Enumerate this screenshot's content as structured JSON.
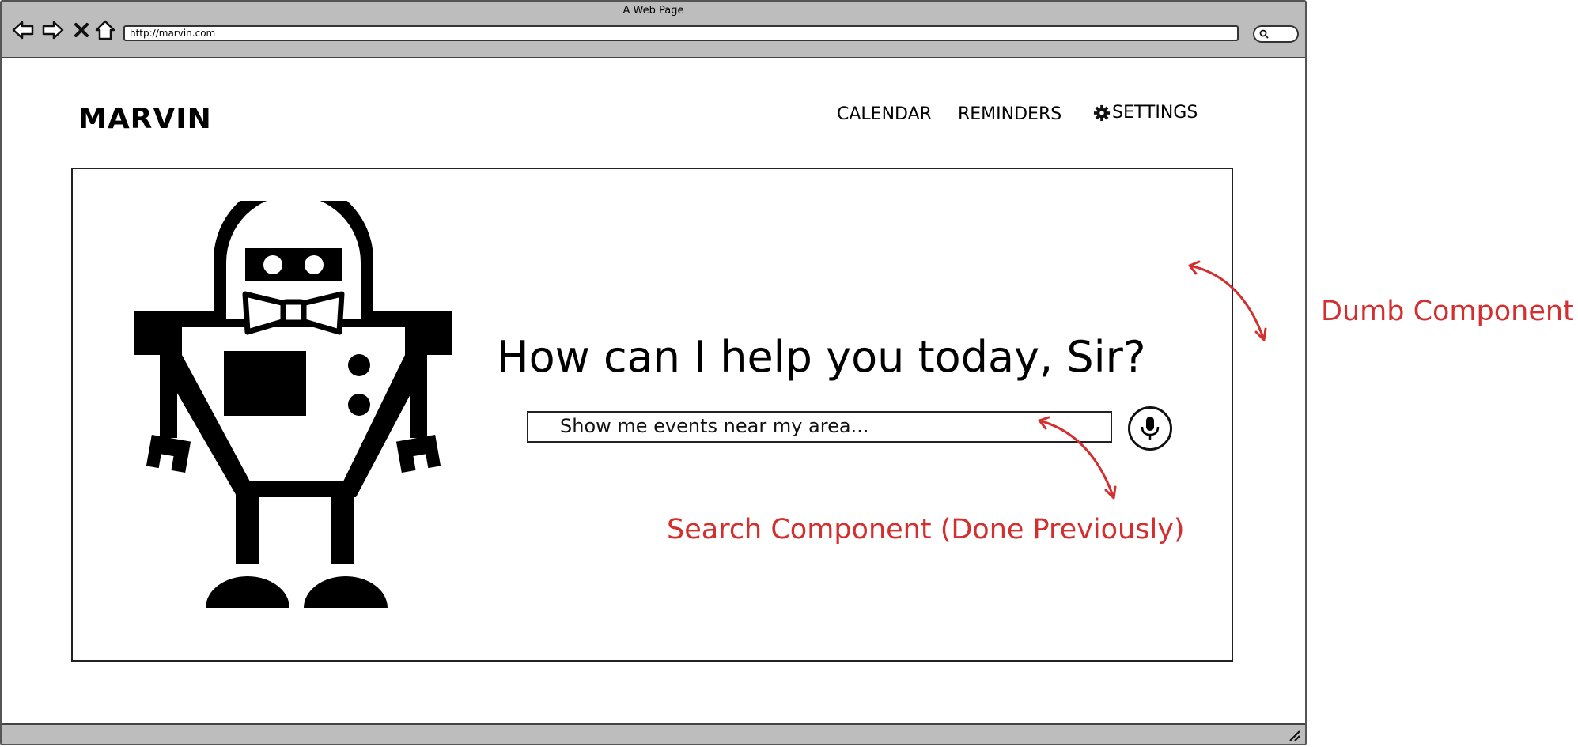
{
  "browser": {
    "window_title": "A Web Page",
    "url": "http://marvin.com"
  },
  "page": {
    "brand": "MARVIN",
    "nav": {
      "calendar": "CALENDAR",
      "reminders": "REMINDERS",
      "settings": "SETTINGS"
    },
    "headline": "How can I help you today, Sir?",
    "search": {
      "value": "Show me events near my area..."
    }
  },
  "annotations": {
    "dumb_component": "Dumb Component",
    "search_component": "Search Component (Done Previously)"
  },
  "icons": {
    "back": "back-arrow-icon",
    "forward": "forward-arrow-icon",
    "stop": "close-icon",
    "home": "home-icon",
    "search": "search-icon",
    "settings": "gear-icon",
    "mic": "microphone-icon",
    "robot": "robot-icon",
    "resize": "resize-grip-icon"
  },
  "colors": {
    "chrome": "#bdbdbd",
    "annotation": "#d32f2f",
    "ink": "#000000"
  }
}
